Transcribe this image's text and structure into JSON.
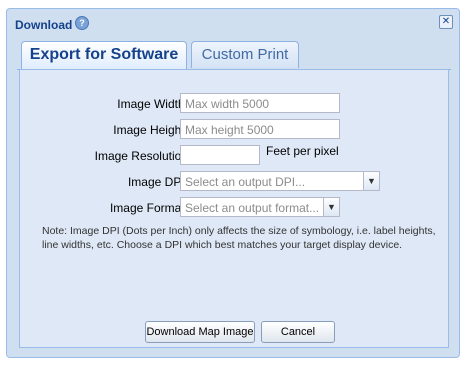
{
  "dialog": {
    "title": "Download"
  },
  "tabs": [
    {
      "label": "Export for Software",
      "active": true
    },
    {
      "label": "Custom Print",
      "active": false
    }
  ],
  "form": {
    "image_width": {
      "label": "Image Width:",
      "placeholder": "Max width 5000"
    },
    "image_height": {
      "label": "Image Height:",
      "placeholder": "Max height 5000"
    },
    "image_resolution": {
      "label": "Image Resolution",
      "value": "",
      "unit": "Feet per pixel"
    },
    "image_dpi": {
      "label": "Image DPI:",
      "placeholder": "Select an output DPI..."
    },
    "image_format": {
      "label": "Image Format:",
      "placeholder": "Select an output format..."
    }
  },
  "note": "Note: Image DPI (Dots per Inch) only affects the size of symbology, i.e. label heights, line widths, etc. Choose a DPI which best matches your target display device.",
  "buttons": {
    "download": "Download Map Image",
    "cancel": "Cancel"
  },
  "colors": {
    "title": "#15428b",
    "panel": "#dfe8f6",
    "frame": "#cfdff0",
    "border": "#99bbe8"
  },
  "icons": {
    "help": "help-icon",
    "close": "close-icon",
    "dropdown": "chevron-down-icon"
  }
}
